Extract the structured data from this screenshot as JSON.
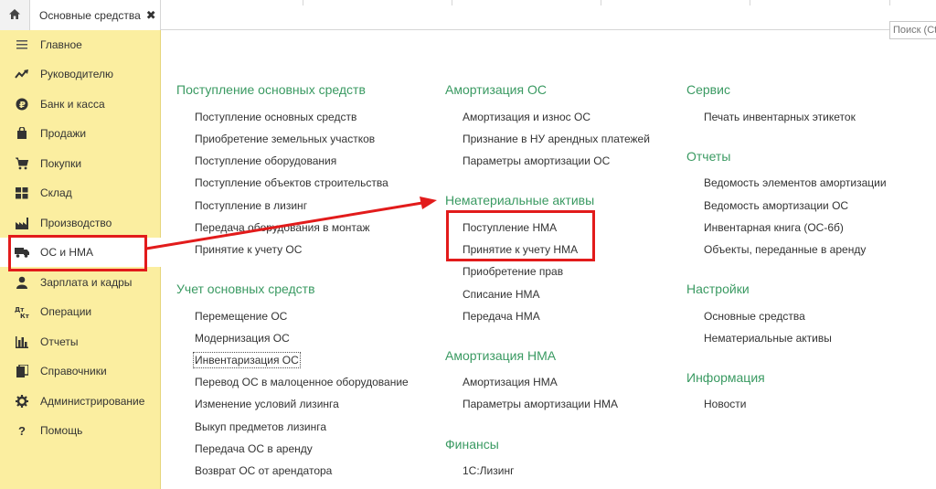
{
  "tabs": {
    "home_icon": "home-icon",
    "active_tab": "Основные средства",
    "close_glyph": "✖"
  },
  "search": {
    "placeholder": "Поиск (Ctrl+F)"
  },
  "sidebar": {
    "items": [
      {
        "label": "Главное",
        "icon": "menu-icon"
      },
      {
        "label": "Руководителю",
        "icon": "trend-icon"
      },
      {
        "label": "Банк и касса",
        "icon": "coin-icon"
      },
      {
        "label": "Продажи",
        "icon": "bag-icon"
      },
      {
        "label": "Покупки",
        "icon": "cart-icon"
      },
      {
        "label": "Склад",
        "icon": "grid-icon"
      },
      {
        "label": "Производство",
        "icon": "factory-icon"
      },
      {
        "label": "ОС и НМА",
        "icon": "truck-icon"
      },
      {
        "label": "Зарплата и кадры",
        "icon": "person-icon"
      },
      {
        "label": "Операции",
        "icon": "dt-kt-icon"
      },
      {
        "label": "Отчеты",
        "icon": "bar-chart-icon"
      },
      {
        "label": "Справочники",
        "icon": "books-icon"
      },
      {
        "label": "Администрирование",
        "icon": "gear-icon"
      },
      {
        "label": "Помощь",
        "icon": "question-icon"
      }
    ]
  },
  "col1": {
    "sec1": {
      "title": "Поступление основных средств",
      "links": [
        "Поступление основных средств",
        "Приобретение земельных участков",
        "Поступление оборудования",
        "Поступление объектов строительства",
        "Поступление в лизинг",
        "Передача оборудования в монтаж",
        "Принятие к учету ОС"
      ]
    },
    "sec2": {
      "title": "Учет основных средств",
      "links": [
        "Перемещение ОС",
        "Модернизация ОС",
        "Инвентаризация ОС",
        "Перевод ОС в малоценное оборудование",
        "Изменение условий лизинга",
        "Выкуп предметов лизинга",
        "Передача ОС в аренду",
        "Возврат ОС от арендатора"
      ]
    }
  },
  "col2": {
    "sec1": {
      "title": "Амортизация ОС",
      "links": [
        "Амортизация и износ ОС",
        "Признание в НУ арендных платежей",
        "Параметры амортизации ОС"
      ]
    },
    "sec2": {
      "title": "Нематериальные активы",
      "links": [
        "Поступление НМА",
        "Принятие к учету НМА",
        "Приобретение прав",
        "Списание НМА",
        "Передача НМА"
      ]
    },
    "sec3": {
      "title": "Амортизация НМА",
      "links": [
        "Амортизация НМА",
        "Параметры амортизации НМА"
      ]
    },
    "sec4": {
      "title": "Финансы",
      "links": [
        "1С:Лизинг"
      ]
    }
  },
  "col3": {
    "sec1": {
      "title": "Сервис",
      "links": [
        "Печать инвентарных этикеток"
      ]
    },
    "sec2": {
      "title": "Отчеты",
      "links": [
        "Ведомость элементов амортизации",
        "Ведомость амортизации ОС",
        "Инвентарная книга (ОС-6б)",
        "Объекты, переданные в аренду"
      ]
    },
    "sec3": {
      "title": "Настройки",
      "links": [
        "Основные средства",
        "Нематериальные активы"
      ]
    },
    "sec4": {
      "title": "Информация",
      "links": [
        "Новости"
      ]
    }
  },
  "colors": {
    "sidebar_bg": "#fbeea0",
    "section_title": "#3a9a62",
    "annotation": "#e21b1b"
  }
}
